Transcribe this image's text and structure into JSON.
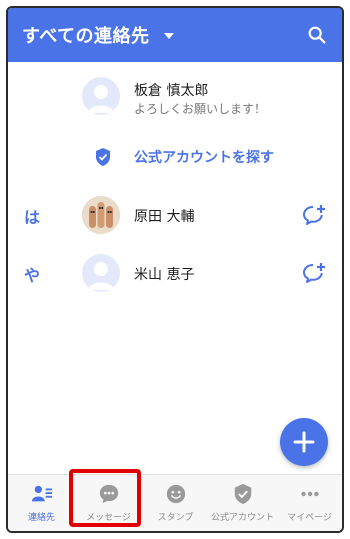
{
  "header": {
    "title": "すべての連絡先"
  },
  "contacts": {
    "profile": {
      "name": "板倉 慎太郎",
      "status": "よろしくお願いします！"
    },
    "official_link": "公式アカウントを探す",
    "sections": [
      {
        "letter": "は",
        "name": "原田 大輔"
      },
      {
        "letter": "や",
        "name": "米山 恵子"
      }
    ]
  },
  "tabs": [
    {
      "label": "連絡先",
      "icon": "contacts-icon",
      "active": true
    },
    {
      "label": "メッセージ",
      "icon": "message-icon",
      "active": false
    },
    {
      "label": "スタンプ",
      "icon": "smile-icon",
      "active": false
    },
    {
      "label": "公式アカウント",
      "icon": "shield-icon",
      "active": false
    },
    {
      "label": "マイページ",
      "icon": "more-icon",
      "active": false
    }
  ],
  "colors": {
    "accent": "#4a73e8",
    "highlight": "#e30000"
  }
}
